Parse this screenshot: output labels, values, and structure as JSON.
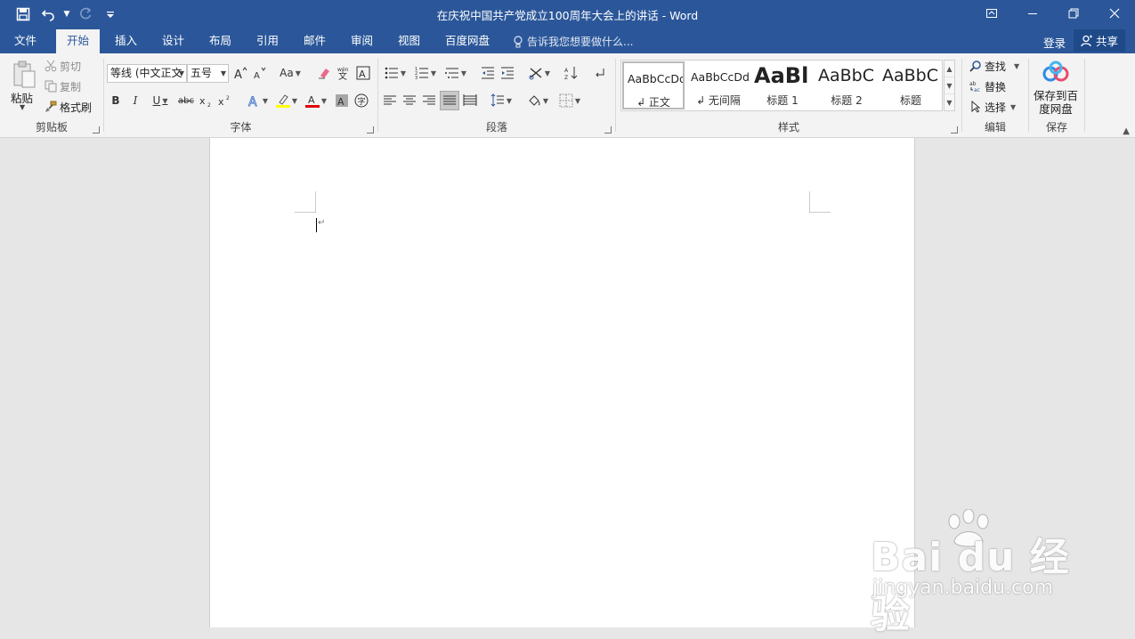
{
  "window": {
    "title": "在庆祝中国共产党成立100周年大会上的讲话 - Word"
  },
  "tabs": [
    {
      "label": "文件"
    },
    {
      "label": "开始"
    },
    {
      "label": "插入"
    },
    {
      "label": "设计"
    },
    {
      "label": "布局"
    },
    {
      "label": "引用"
    },
    {
      "label": "邮件"
    },
    {
      "label": "审阅"
    },
    {
      "label": "视图"
    },
    {
      "label": "百度网盘"
    }
  ],
  "tell_me": "告诉我您想要做什么...",
  "account": {
    "login": "登录",
    "share": "共享"
  },
  "clipboard": {
    "paste": "粘贴",
    "cut": "剪切",
    "copy": "复制",
    "format_painter": "格式刷",
    "group_label": "剪贴板"
  },
  "font": {
    "name": "等线 (中文正文",
    "size": "五号",
    "change_case": "Aa",
    "group_label": "字体"
  },
  "paragraph": {
    "group_label": "段落"
  },
  "styles": {
    "items": [
      {
        "sample": "AaBbCcDd",
        "name": "↲ 正文"
      },
      {
        "sample": "AaBbCcDd",
        "name": "↲ 无间隔"
      },
      {
        "sample": "AaBl",
        "name": "标题 1"
      },
      {
        "sample": "AaBbC",
        "name": "标题 2"
      },
      {
        "sample": "AaBbC",
        "name": "标题"
      }
    ],
    "group_label": "样式"
  },
  "editing": {
    "find": "查找",
    "replace": "替换",
    "select": "选择",
    "group_label": "编辑"
  },
  "save": {
    "save_to_baidu": "保存到百度网盘",
    "group_label": "保存"
  },
  "watermark": {
    "main": "Bai du 经验",
    "sub": "jingyan.baidu.com"
  },
  "colors": {
    "brand": "#2b579a",
    "highlight": "#ffff00",
    "font_color": "#e00000"
  }
}
